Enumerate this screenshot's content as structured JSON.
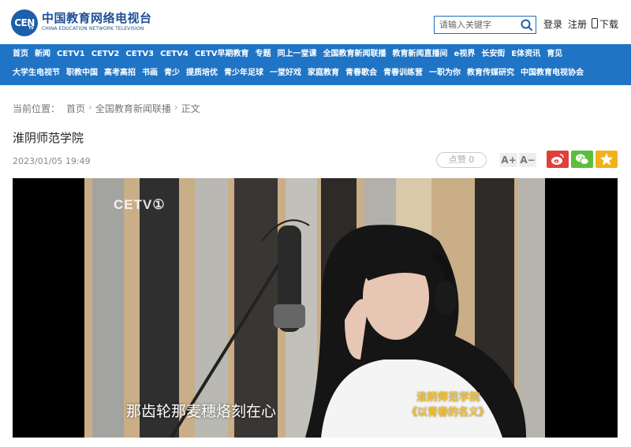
{
  "header": {
    "logo_mark": "CEN",
    "logo_mark_sub": "TV",
    "logo_title": "中国教育网络电视台",
    "logo_subtitle": "CHINA EDUCATION NETWORK TELEVISION",
    "search_placeholder": "请输入关键字",
    "login": "登录",
    "register": "注册",
    "download": "下载",
    "icons": {
      "search": "search-icon",
      "download": "phone-icon"
    }
  },
  "nav": {
    "row1": [
      "首页",
      "新闻",
      "CETV1",
      "CETV2",
      "CETV3",
      "CETV4",
      "CETV早期教育",
      "专题",
      "同上一堂课",
      "全国教育新闻联播",
      "教育新闻直播间",
      "e视界",
      "长安街",
      "E体资讯",
      "育见"
    ],
    "row2": [
      "大学生电视节",
      "职教中国",
      "高考高招",
      "书画",
      "青少",
      "提质培优",
      "青少年足球",
      "一堂好戏",
      "家庭教育",
      "青春歌会",
      "青春训练营",
      "一职为你",
      "教育传媒研究",
      "中国教育电视协会"
    ],
    "background_color": "#1f74c6"
  },
  "breadcrumb": {
    "lead": "当前位置：",
    "items": [
      "首页",
      "全国教育新闻联播",
      "正文"
    ],
    "separator": "›"
  },
  "article": {
    "title": "淮阴师范学院",
    "date": "2023/01/05 19:49",
    "like_label": "点赞",
    "like_count": "0",
    "font_up": "A+",
    "font_down": "A−",
    "share_icons": [
      "weibo-icon",
      "wechat-icon",
      "star-icon"
    ]
  },
  "video": {
    "channel_logo": "CETV①",
    "subtitle": "那齿轮那麦穗烙刻在心",
    "brand_line1": "淮阴师范学院",
    "brand_line2": "《以青春的名义》"
  }
}
